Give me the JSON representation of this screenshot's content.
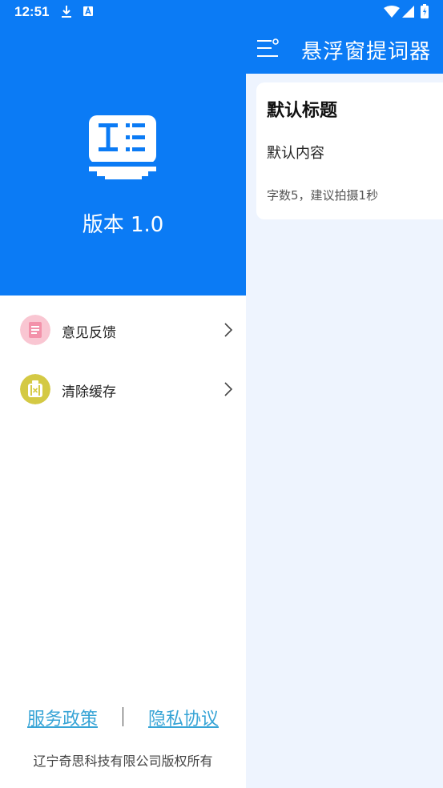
{
  "status_bar": {
    "time": "12:51"
  },
  "app_bar": {
    "title": "悬浮窗提词器"
  },
  "card": {
    "title": "默认标题",
    "content": "默认内容",
    "info": "字数5，建议拍摄1秒"
  },
  "drawer": {
    "version": "版本 1.0",
    "menu": [
      {
        "label": "意见反馈",
        "icon": "feedback-icon",
        "icon_color": "#F9C6D2"
      },
      {
        "label": "清除缓存",
        "icon": "clear-cache-icon",
        "icon_color": "#D4C944"
      }
    ],
    "links": {
      "service_policy": "服务政策",
      "privacy_agreement": "隐私协议"
    },
    "copyright": "辽宁奇思科技有限公司版权所有"
  },
  "colors": {
    "primary": "#0B7BF5",
    "link": "#37A4D6",
    "background": "#EEF4FE"
  }
}
